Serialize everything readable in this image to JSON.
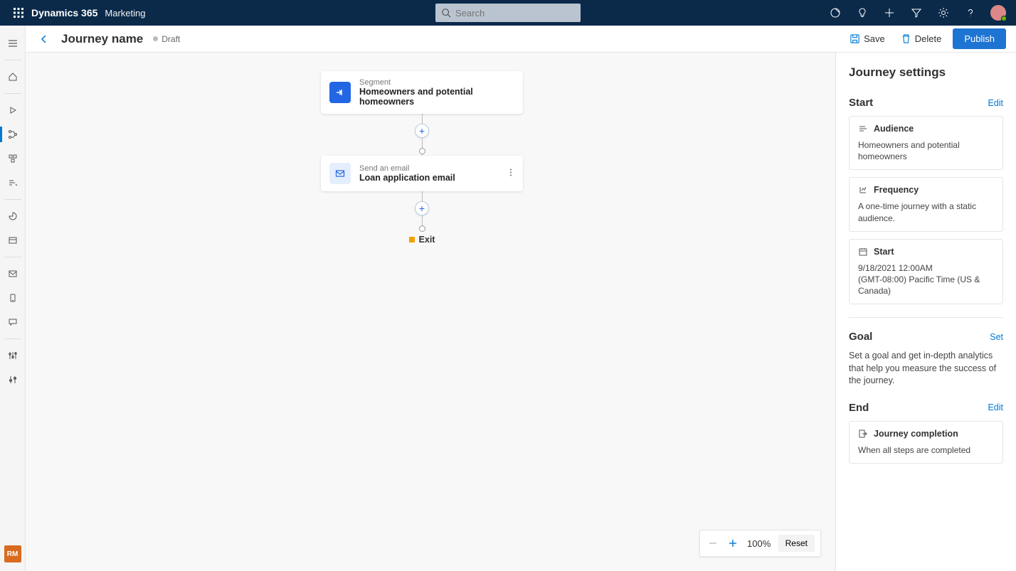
{
  "brand": "Dynamics 365",
  "module": "Marketing",
  "search_placeholder": "Search",
  "page": {
    "title": "Journey name",
    "status": "Draft",
    "actions": {
      "save": "Save",
      "delete": "Delete",
      "publish": "Publish"
    }
  },
  "leftrail_badge": "RM",
  "flow": {
    "segment": {
      "kicker": "Segment",
      "title": "Homeowners and potential homeowners"
    },
    "email": {
      "kicker": "Send an email",
      "title": "Loan application email"
    },
    "exit": "Exit"
  },
  "zoom": {
    "value": "100%",
    "reset": "Reset"
  },
  "panel": {
    "title": "Journey settings",
    "start": {
      "heading": "Start",
      "edit": "Edit",
      "audience": {
        "label": "Audience",
        "value": "Homeowners and potential homeowners"
      },
      "frequency": {
        "label": "Frequency",
        "value": "A one-time journey with a static audience."
      },
      "starttime": {
        "label": "Start",
        "datetime": "9/18/2021 12:00AM",
        "tz": "(GMT-08:00) Pacific Time (US & Canada)"
      }
    },
    "goal": {
      "heading": "Goal",
      "set": "Set",
      "desc": "Set a goal and get in-depth analytics that help you measure the success of the journey."
    },
    "end": {
      "heading": "End",
      "edit": "Edit",
      "completion": {
        "label": "Journey completion",
        "value": "When all steps are completed"
      }
    }
  }
}
